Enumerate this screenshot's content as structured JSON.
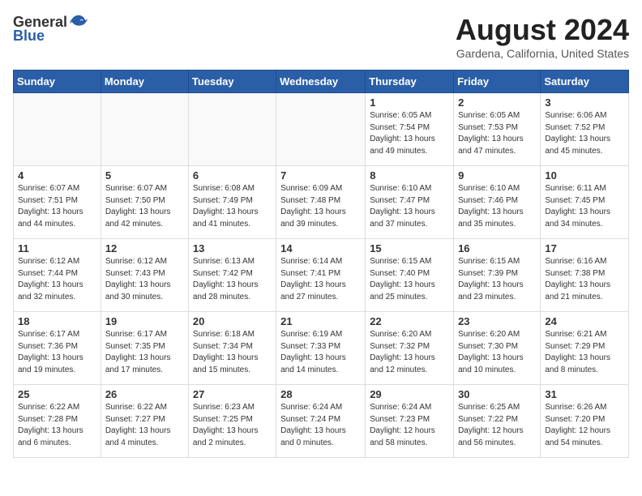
{
  "logo": {
    "general": "General",
    "blue": "Blue"
  },
  "title": {
    "month_year": "August 2024",
    "location": "Gardena, California, United States"
  },
  "days_of_week": [
    "Sunday",
    "Monday",
    "Tuesday",
    "Wednesday",
    "Thursday",
    "Friday",
    "Saturday"
  ],
  "weeks": [
    [
      {
        "day": "",
        "info": ""
      },
      {
        "day": "",
        "info": ""
      },
      {
        "day": "",
        "info": ""
      },
      {
        "day": "",
        "info": ""
      },
      {
        "day": "1",
        "info": "Sunrise: 6:05 AM\nSunset: 7:54 PM\nDaylight: 13 hours\nand 49 minutes."
      },
      {
        "day": "2",
        "info": "Sunrise: 6:05 AM\nSunset: 7:53 PM\nDaylight: 13 hours\nand 47 minutes."
      },
      {
        "day": "3",
        "info": "Sunrise: 6:06 AM\nSunset: 7:52 PM\nDaylight: 13 hours\nand 45 minutes."
      }
    ],
    [
      {
        "day": "4",
        "info": "Sunrise: 6:07 AM\nSunset: 7:51 PM\nDaylight: 13 hours\nand 44 minutes."
      },
      {
        "day": "5",
        "info": "Sunrise: 6:07 AM\nSunset: 7:50 PM\nDaylight: 13 hours\nand 42 minutes."
      },
      {
        "day": "6",
        "info": "Sunrise: 6:08 AM\nSunset: 7:49 PM\nDaylight: 13 hours\nand 41 minutes."
      },
      {
        "day": "7",
        "info": "Sunrise: 6:09 AM\nSunset: 7:48 PM\nDaylight: 13 hours\nand 39 minutes."
      },
      {
        "day": "8",
        "info": "Sunrise: 6:10 AM\nSunset: 7:47 PM\nDaylight: 13 hours\nand 37 minutes."
      },
      {
        "day": "9",
        "info": "Sunrise: 6:10 AM\nSunset: 7:46 PM\nDaylight: 13 hours\nand 35 minutes."
      },
      {
        "day": "10",
        "info": "Sunrise: 6:11 AM\nSunset: 7:45 PM\nDaylight: 13 hours\nand 34 minutes."
      }
    ],
    [
      {
        "day": "11",
        "info": "Sunrise: 6:12 AM\nSunset: 7:44 PM\nDaylight: 13 hours\nand 32 minutes."
      },
      {
        "day": "12",
        "info": "Sunrise: 6:12 AM\nSunset: 7:43 PM\nDaylight: 13 hours\nand 30 minutes."
      },
      {
        "day": "13",
        "info": "Sunrise: 6:13 AM\nSunset: 7:42 PM\nDaylight: 13 hours\nand 28 minutes."
      },
      {
        "day": "14",
        "info": "Sunrise: 6:14 AM\nSunset: 7:41 PM\nDaylight: 13 hours\nand 27 minutes."
      },
      {
        "day": "15",
        "info": "Sunrise: 6:15 AM\nSunset: 7:40 PM\nDaylight: 13 hours\nand 25 minutes."
      },
      {
        "day": "16",
        "info": "Sunrise: 6:15 AM\nSunset: 7:39 PM\nDaylight: 13 hours\nand 23 minutes."
      },
      {
        "day": "17",
        "info": "Sunrise: 6:16 AM\nSunset: 7:38 PM\nDaylight: 13 hours\nand 21 minutes."
      }
    ],
    [
      {
        "day": "18",
        "info": "Sunrise: 6:17 AM\nSunset: 7:36 PM\nDaylight: 13 hours\nand 19 minutes."
      },
      {
        "day": "19",
        "info": "Sunrise: 6:17 AM\nSunset: 7:35 PM\nDaylight: 13 hours\nand 17 minutes."
      },
      {
        "day": "20",
        "info": "Sunrise: 6:18 AM\nSunset: 7:34 PM\nDaylight: 13 hours\nand 15 minutes."
      },
      {
        "day": "21",
        "info": "Sunrise: 6:19 AM\nSunset: 7:33 PM\nDaylight: 13 hours\nand 14 minutes."
      },
      {
        "day": "22",
        "info": "Sunrise: 6:20 AM\nSunset: 7:32 PM\nDaylight: 13 hours\nand 12 minutes."
      },
      {
        "day": "23",
        "info": "Sunrise: 6:20 AM\nSunset: 7:30 PM\nDaylight: 13 hours\nand 10 minutes."
      },
      {
        "day": "24",
        "info": "Sunrise: 6:21 AM\nSunset: 7:29 PM\nDaylight: 13 hours\nand 8 minutes."
      }
    ],
    [
      {
        "day": "25",
        "info": "Sunrise: 6:22 AM\nSunset: 7:28 PM\nDaylight: 13 hours\nand 6 minutes."
      },
      {
        "day": "26",
        "info": "Sunrise: 6:22 AM\nSunset: 7:27 PM\nDaylight: 13 hours\nand 4 minutes."
      },
      {
        "day": "27",
        "info": "Sunrise: 6:23 AM\nSunset: 7:25 PM\nDaylight: 13 hours\nand 2 minutes."
      },
      {
        "day": "28",
        "info": "Sunrise: 6:24 AM\nSunset: 7:24 PM\nDaylight: 13 hours\nand 0 minutes."
      },
      {
        "day": "29",
        "info": "Sunrise: 6:24 AM\nSunset: 7:23 PM\nDaylight: 12 hours\nand 58 minutes."
      },
      {
        "day": "30",
        "info": "Sunrise: 6:25 AM\nSunset: 7:22 PM\nDaylight: 12 hours\nand 56 minutes."
      },
      {
        "day": "31",
        "info": "Sunrise: 6:26 AM\nSunset: 7:20 PM\nDaylight: 12 hours\nand 54 minutes."
      }
    ]
  ]
}
